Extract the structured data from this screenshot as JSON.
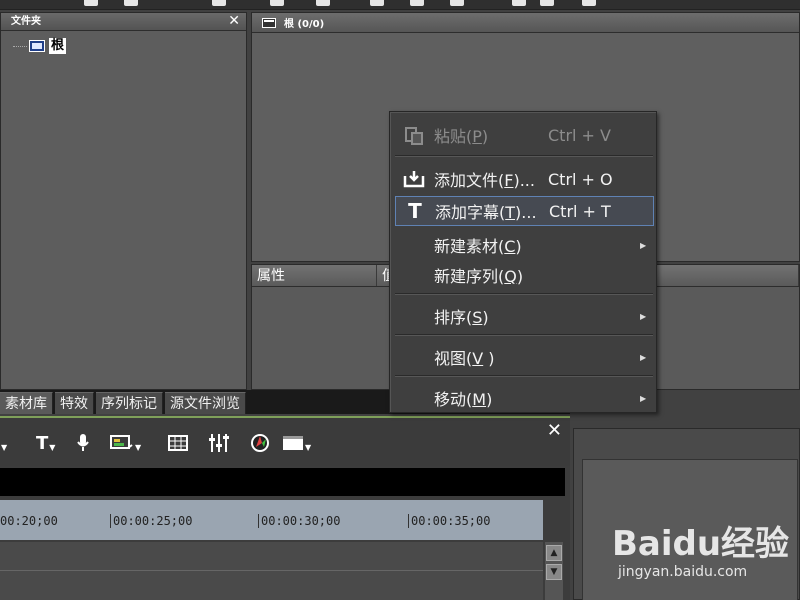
{
  "folder_panel": {
    "title": "文件夹",
    "close_label": "✕",
    "root_label": "根"
  },
  "bin_panel": {
    "title": "根 (0/0)"
  },
  "properties_panel": {
    "col_property": "属性",
    "col_value": "值"
  },
  "tabs": [
    {
      "label": "素材库"
    },
    {
      "label": "特效"
    },
    {
      "label": "序列标记"
    },
    {
      "label": "源文件浏览"
    }
  ],
  "timeline": {
    "close_label": "✕",
    "timecodes": [
      "00:20;00",
      "00:00:25;00",
      "00:00:30;00",
      "00:00:35;00"
    ]
  },
  "context_menu": {
    "items": [
      {
        "label": "粘贴(",
        "mnemonic": "P",
        "suffix": ")",
        "shortcut": "Ctrl + V",
        "disabled": true,
        "icon": "clipboard-paste-icon"
      },
      {
        "label": "添加文件(",
        "mnemonic": "F",
        "suffix": ")...",
        "shortcut": "Ctrl + O",
        "disabled": false,
        "icon": "add-file-icon"
      },
      {
        "label": "添加字幕(",
        "mnemonic": "T",
        "suffix": ")...",
        "shortcut": "Ctrl + T",
        "disabled": false,
        "icon": "title-text-icon",
        "highlighted": true
      },
      {
        "label": "新建素材(",
        "mnemonic": "C",
        "suffix": ")",
        "submenu": true
      },
      {
        "label": "新建序列(",
        "mnemonic": "Q",
        "suffix": ")"
      },
      {
        "label": "排序(",
        "mnemonic": "S",
        "suffix": ")",
        "submenu": true
      },
      {
        "label": "视图(",
        "mnemonic": "V",
        "suffix": " )",
        "submenu": true
      },
      {
        "label": "移动(",
        "mnemonic": "M",
        "suffix": ")",
        "submenu": true
      }
    ]
  },
  "watermark": {
    "logo": "Baidu经验",
    "url": "jingyan.baidu.com"
  },
  "colors": {
    "menu_highlight_border": "#5f82b4",
    "timeline_accent": "#7fa05a"
  }
}
